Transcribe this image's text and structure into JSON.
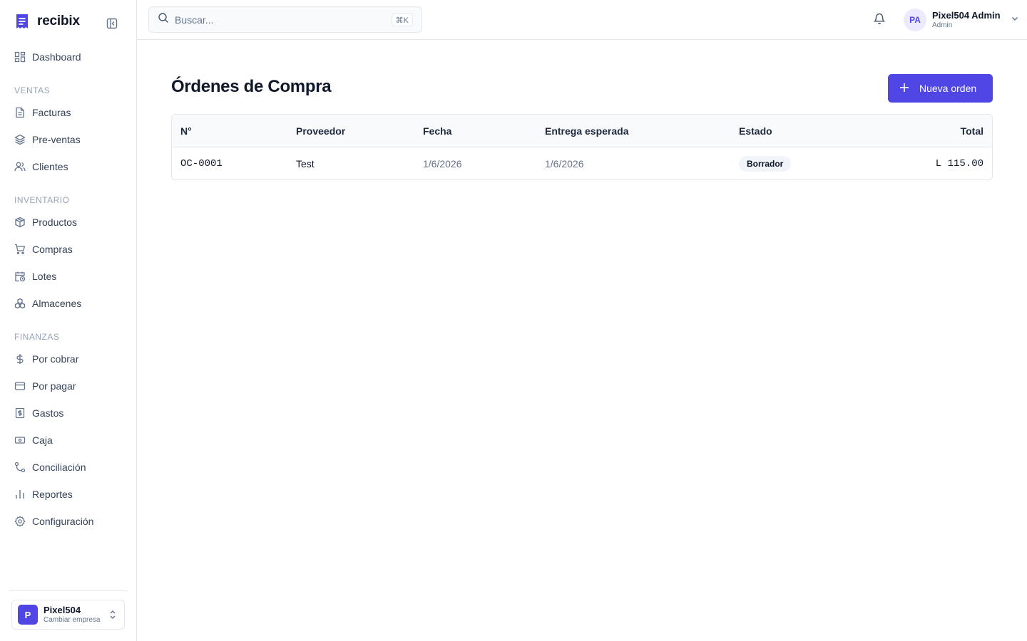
{
  "brand": {
    "name": "recibix"
  },
  "sidebar": {
    "dashboard": "Dashboard",
    "sections": [
      {
        "title": "VENTAS",
        "items": [
          "Facturas",
          "Pre-ventas",
          "Clientes"
        ]
      },
      {
        "title": "INVENTARIO",
        "items": [
          "Productos",
          "Compras",
          "Lotes",
          "Almacenes"
        ]
      },
      {
        "title": "FINANZAS",
        "items": [
          "Por cobrar",
          "Por pagar",
          "Gastos",
          "Caja",
          "Conciliación",
          "Reportes",
          "Configuración"
        ]
      }
    ],
    "company": {
      "initial": "P",
      "name": "Pixel504",
      "sub": "Cambiar empresa"
    }
  },
  "topbar": {
    "search_placeholder": "Buscar...",
    "search_shortcut": "⌘K",
    "user": {
      "initials": "PA",
      "name": "Pixel504 Admin",
      "role": "Admin"
    }
  },
  "main": {
    "title": "Órdenes de Compra",
    "new_button": "Nueva orden",
    "table": {
      "headers": [
        "N°",
        "Proveedor",
        "Fecha",
        "Entrega esperada",
        "Estado",
        "Total"
      ],
      "rows": [
        {
          "number": "OC-0001",
          "supplier": "Test",
          "date": "1/6/2026",
          "expected": "1/6/2026",
          "status": "Borrador",
          "total": "L 115.00"
        }
      ]
    }
  },
  "colors": {
    "accent": "#4f46e5",
    "border": "#e5e7eb",
    "muted": "#64748b"
  }
}
